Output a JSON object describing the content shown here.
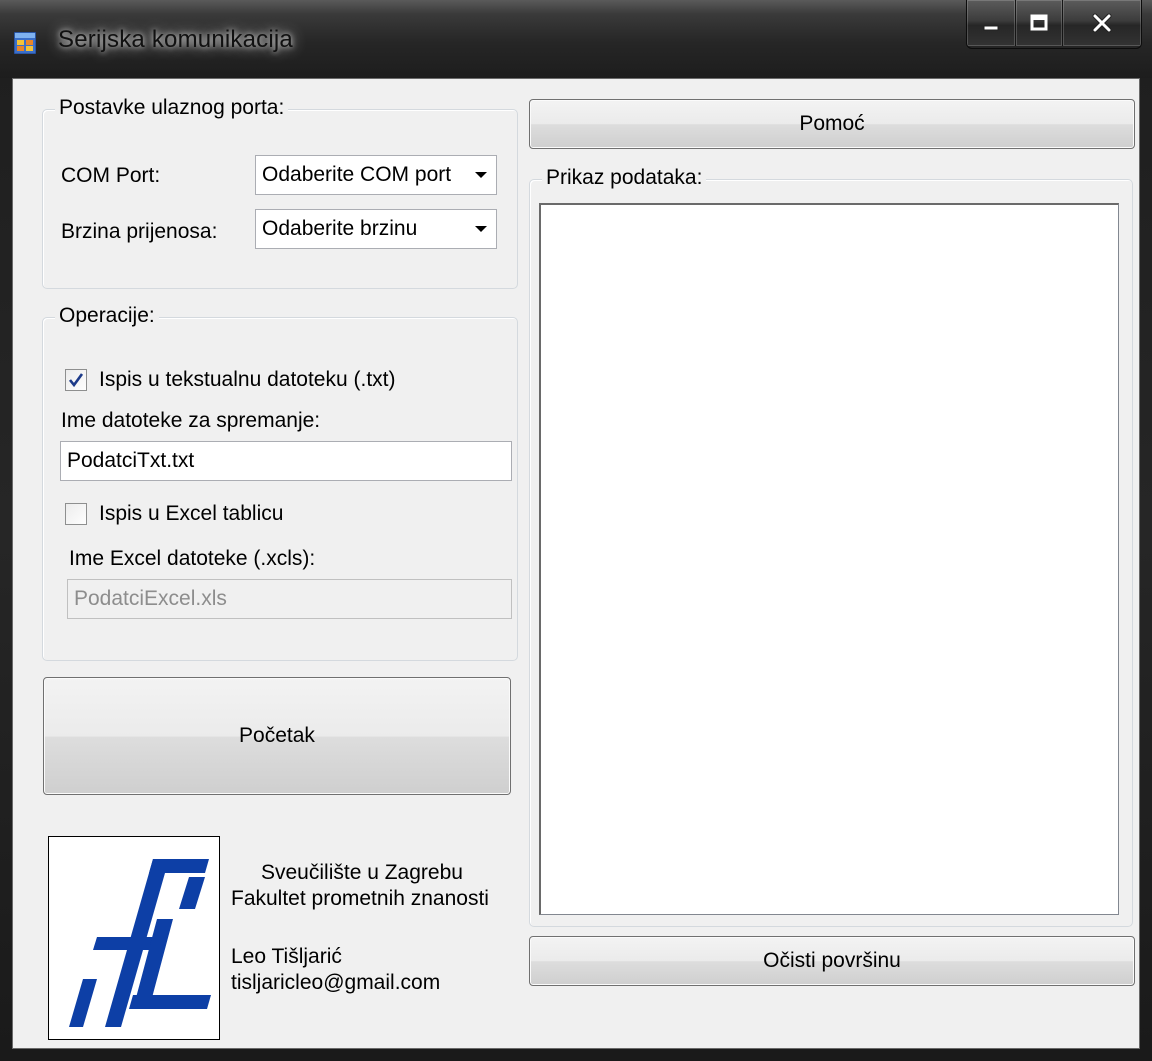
{
  "window": {
    "title": "Serijska komunikacija"
  },
  "port_settings": {
    "legend": "Postavke ulaznog porta:",
    "com_port_label": "COM Port:",
    "com_port_value": "Odaberite COM port",
    "baud_label": "Brzina prijenosa:",
    "baud_value": "Odaberite brzinu"
  },
  "operations": {
    "legend": "Operacije:",
    "txt_checkbox_label": "Ispis u tekstualnu datoteku (.txt)",
    "txt_checked": true,
    "txt_filename_label": "Ime datoteke za spremanje:",
    "txt_filename_value": "PodatciTxt.txt",
    "excel_checkbox_label": "Ispis u Excel tablicu",
    "excel_checked": false,
    "excel_filename_label": "Ime Excel datoteke (.xcls):",
    "excel_filename_value": "PodatciExcel.xls"
  },
  "buttons": {
    "start": "Početak",
    "help": "Pomoć",
    "clear": "Očisti površinu"
  },
  "data_display": {
    "legend": "Prikaz podataka:"
  },
  "footer": {
    "university": "Sveučilište u Zagrebu",
    "faculty": "Fakultet prometnih znanosti",
    "author": "Leo Tišljarić",
    "email": "tisljaricleo@gmail.com"
  },
  "colors": {
    "logo_blue": "#0d3fa6"
  }
}
